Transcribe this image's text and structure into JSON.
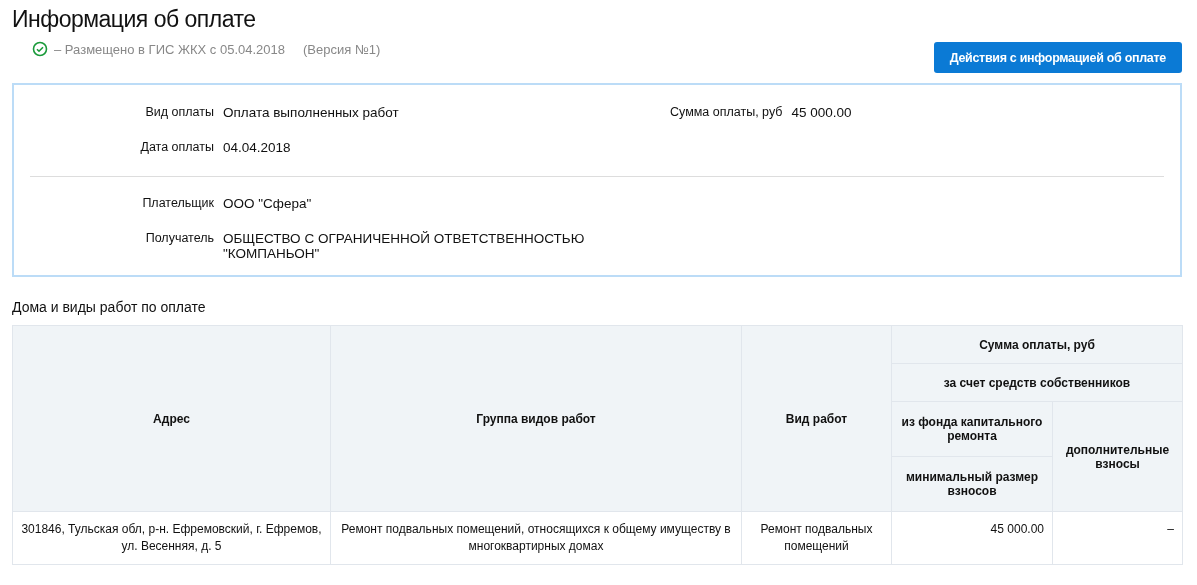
{
  "title": "Информация об оплате",
  "status": {
    "text": "–  Размещено в ГИС ЖКХ с 05.04.2018",
    "version": "(Версия №1)"
  },
  "actions_button": "Действия с информацией об оплате",
  "payment": {
    "left": [
      {
        "label": "Вид оплаты",
        "value": "Оплата выполненных работ"
      },
      {
        "label": "Дата оплаты",
        "value": "04.04.2018"
      }
    ],
    "right": [
      {
        "label": "Сумма оплаты, руб",
        "value": "45 000.00"
      }
    ],
    "parties": [
      {
        "label": "Плательщик",
        "value": "ООО \"Сфера\""
      },
      {
        "label": "Получатель",
        "value": "ОБЩЕСТВО С ОГРАНИЧЕННОЙ ОТВЕТСТВЕННОСТЬЮ \"КОМПАНЬОН\""
      }
    ]
  },
  "section_title": "Дома и виды работ по оплате",
  "table": {
    "header": {
      "address": "Адрес",
      "work_group": "Группа видов работ",
      "work_type": "Вид работ",
      "sum": "Сумма оплаты, руб",
      "owners_funds": "за счет средств собственников",
      "capital_fund": "из фонда капитального ремонта",
      "min_contribution": "минимальный размер взносов",
      "additional": "дополнительные взносы"
    },
    "rows": [
      {
        "address": "301846, Тульская обл, р-н. Ефремовский, г. Ефремов, ул. Весенняя, д. 5",
        "work_group": "Ремонт подвальных помещений, относящихся к общему имуществу в многоквартирных домах",
        "work_type": "Ремонт подвальных помещений",
        "min_contribution": "45 000.00",
        "additional": "–"
      }
    ]
  }
}
